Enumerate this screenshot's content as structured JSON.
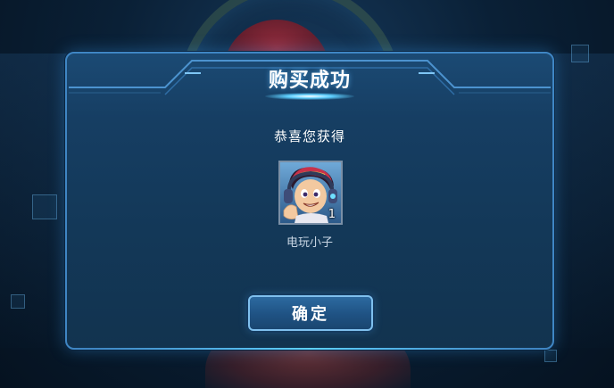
{
  "dialog": {
    "title": "购买成功",
    "subtitle": "恭喜您获得",
    "reward": {
      "name": "电玩小子",
      "count": "1",
      "icon": "hero-skin-portrait-icon"
    },
    "confirm_label": "确定"
  },
  "colors": {
    "dialog_border": "#3f86c4",
    "dialog_fill": "#163e63",
    "accent_glow": "#5fd0ff",
    "button_fill": "#1f5283"
  }
}
